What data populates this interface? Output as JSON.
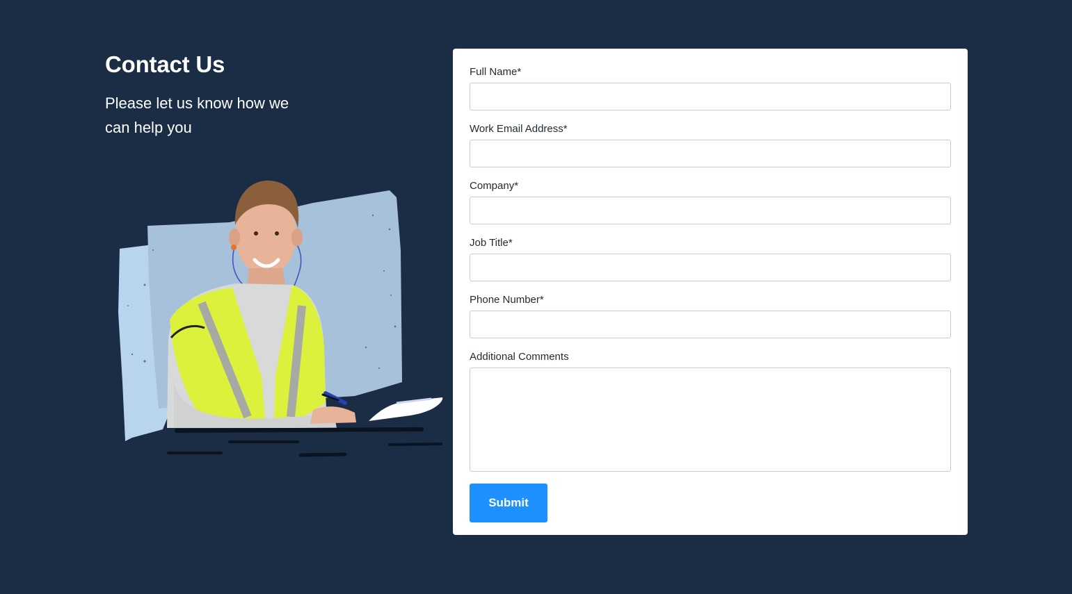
{
  "page": {
    "background_color": "#1b2d45"
  },
  "header": {
    "title": "Contact Us",
    "subtitle": "Please let us know how we can help you"
  },
  "illustration": {
    "subject": "smiling worker in high-visibility safety vest writing on clipboard",
    "backdrop_color": "#a8c1da"
  },
  "form": {
    "fields": [
      {
        "label": "Full Name*",
        "value": "",
        "placeholder": ""
      },
      {
        "label": "Work Email Address*",
        "value": "",
        "placeholder": ""
      },
      {
        "label": "Company*",
        "value": "",
        "placeholder": ""
      },
      {
        "label": "Job Title*",
        "value": "",
        "placeholder": ""
      },
      {
        "label": "Phone Number*",
        "value": "",
        "placeholder": ""
      },
      {
        "label": "Additional Comments",
        "value": "",
        "placeholder": ""
      }
    ],
    "submit_label": "Submit",
    "submit_color": "#1e90ff"
  }
}
